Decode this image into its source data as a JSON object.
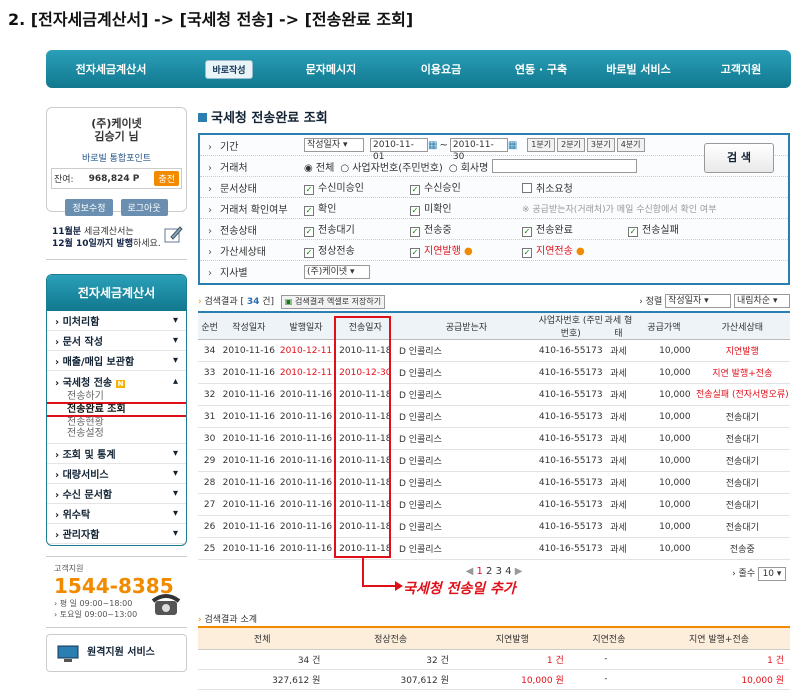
{
  "heading": "2. [전자세금계산서] -> [국세청 전송] -> [전송완료 조회]",
  "nav": {
    "items": [
      "전자세금계산서",
      "바로작성",
      "문자메시지",
      "이용요금",
      "연동 · 구축",
      "바로빌 서비스",
      "고객지원"
    ]
  },
  "user": {
    "company": "(주)케이넷",
    "name": "김승기 님",
    "point_label": "바로빌 통합포인트",
    "balance_label": "잔여:",
    "balance": "968,824 P",
    "charge": "충전",
    "info_btn": "정보수정",
    "logout_btn": "로그아웃"
  },
  "notice": {
    "line1a": "11월분",
    "line1b": " 세금계산서는",
    "line2a": "12월 10일까지 발행",
    "line2b": "하세요."
  },
  "menu": {
    "title": "전자세금계산서",
    "items": [
      "미처리함",
      "문서 작성",
      "매출/매입 보관함",
      "국세청 전송"
    ],
    "subs": [
      "전송하기",
      "전송완료 조회",
      "전송현황",
      "전송설정"
    ],
    "items2": [
      "조회 및 통계",
      "대량서비스",
      "수신 문서함",
      "위수탁",
      "관리자함"
    ]
  },
  "contact": {
    "label": "고객지원",
    "phone": "1544-8385",
    "weekday": "› 평 일 09:00~18:00",
    "sat": "› 토요일 09:00~13:00"
  },
  "remote": "원격지원 서비스",
  "page_title": "국세청 전송완료 조회",
  "search": {
    "period_label": "기간",
    "period_type": "작성일자",
    "from": "2010-11-01",
    "to": "2010-11-30",
    "tilde": "~",
    "q": [
      "1분기",
      "2분기",
      "3분기",
      "4분기"
    ],
    "partner_label": "거래처",
    "partner_opts": [
      "전체",
      "사업자번호(주민번호)",
      "회사명"
    ],
    "doc_label": "문서상태",
    "doc_opts": [
      "수신미승인",
      "수신승인",
      "취소요청"
    ],
    "confirm_label": "거래처 확인여부",
    "confirm_opts": [
      "확인",
      "미확인"
    ],
    "confirm_note": "※ 공급받는자(거래처)가 메일 수신함에서 확인 여부",
    "send_label": "전송상태",
    "send_opts": [
      "전송대기",
      "전송중",
      "전송완료",
      "전송실패"
    ],
    "tax_label": "가산세상태",
    "tax_opts": [
      "정상전송",
      "지연발행",
      "지연전송"
    ],
    "branch_label": "지사별",
    "branch": "(주)케이넷",
    "go": "검 색"
  },
  "result": {
    "label": "검색결과",
    "count": "34",
    "count_unit": "건",
    "excel": "검색결과 엑셀로 저장하기",
    "sort_label": "› 정렬",
    "sort": "작성일자",
    "order": "내림차순"
  },
  "table": {
    "headers": [
      "순번",
      "작성일자",
      "발행일자",
      "전송일자",
      "공급받는자",
      "사업자번호 (주민번호)",
      "과세 형태",
      "공급가액",
      "가산세상태"
    ],
    "rows": [
      [
        "34",
        "2010-11-16",
        "2010-12-11",
        "2010-11-18",
        "D 인콜리스",
        "410-16-55173",
        "과세",
        "10,000",
        "지연발행"
      ],
      [
        "33",
        "2010-11-16",
        "2010-12-11",
        "2010-12-30",
        "D 인콜리스",
        "410-16-55173",
        "과세",
        "10,000",
        "지연 발행+전송"
      ],
      [
        "32",
        "2010-11-16",
        "2010-11-16",
        "2010-11-18",
        "D 인콜리스",
        "410-16-55173",
        "과세",
        "10,000",
        "전송실패 (전자서명오류)"
      ],
      [
        "31",
        "2010-11-16",
        "2010-11-16",
        "2010-11-18",
        "D 인콜리스",
        "410-16-55173",
        "과세",
        "10,000",
        "전송대기"
      ],
      [
        "30",
        "2010-11-16",
        "2010-11-16",
        "2010-11-18",
        "D 인콜리스",
        "410-16-55173",
        "과세",
        "10,000",
        "전송대기"
      ],
      [
        "29",
        "2010-11-16",
        "2010-11-16",
        "2010-11-18",
        "D 인콜리스",
        "410-16-55173",
        "과세",
        "10,000",
        "전송대기"
      ],
      [
        "28",
        "2010-11-16",
        "2010-11-16",
        "2010-11-18",
        "D 인콜리스",
        "410-16-55173",
        "과세",
        "10,000",
        "전송대기"
      ],
      [
        "27",
        "2010-11-16",
        "2010-11-16",
        "2010-11-18",
        "D 인콜리스",
        "410-16-55173",
        "과세",
        "10,000",
        "전송대기"
      ],
      [
        "26",
        "2010-11-16",
        "2010-11-16",
        "2010-11-18",
        "D 인콜리스",
        "410-16-55173",
        "과세",
        "10,000",
        "전송대기"
      ],
      [
        "25",
        "2010-11-16",
        "2010-11-16",
        "2010-11-18",
        "D 인콜리스",
        "410-16-55173",
        "과세",
        "10,000",
        "전송중"
      ]
    ]
  },
  "pager": {
    "pages": [
      "1",
      "2",
      "3",
      "4"
    ],
    "rows_label": "› 줄수",
    "rows": "10"
  },
  "callout": "국세청 전송일 추가",
  "summary": {
    "label": "검색결과 소계",
    "headers": [
      "전체",
      "정상전송",
      "지연발행",
      "지연전송",
      "지연 발행+전송"
    ],
    "row1": [
      "34 건",
      "32 건",
      "1 건",
      "-",
      "1 건"
    ],
    "row2": [
      "327,612 원",
      "307,612 원",
      "10,000 원",
      "-",
      "10,000 원"
    ]
  },
  "colors": {
    "accent": "#1b8aa5",
    "highlight": "#e0101a",
    "orange": "#f28a00"
  }
}
